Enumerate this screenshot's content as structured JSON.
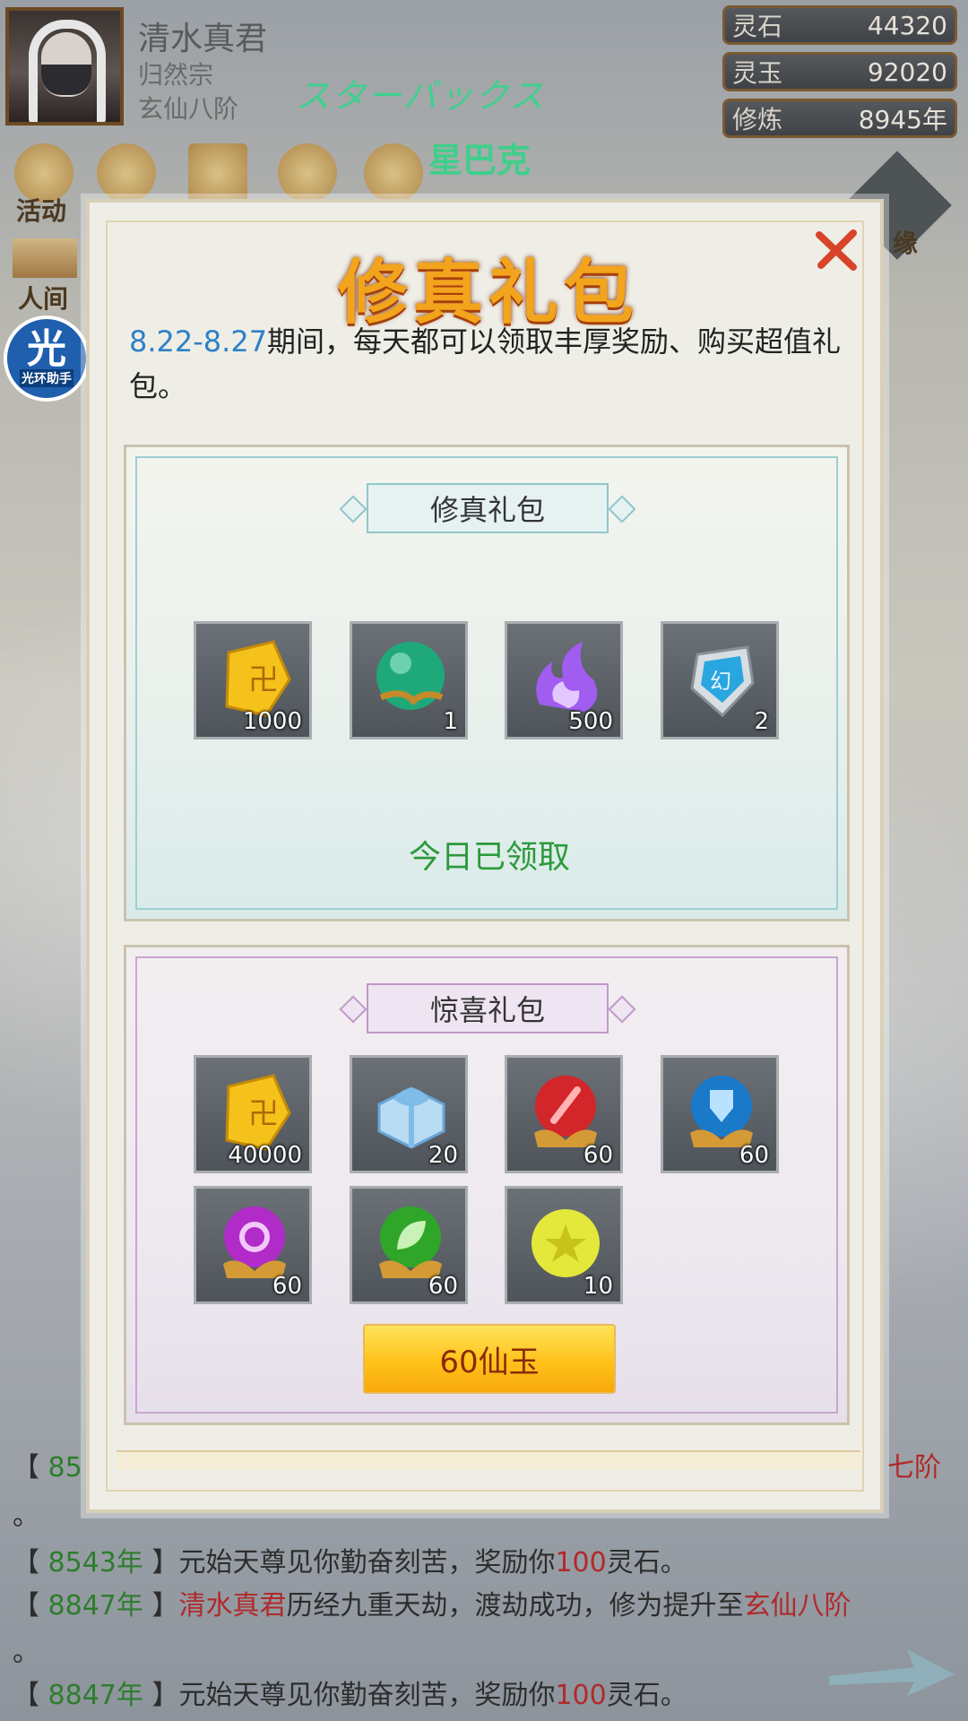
{
  "player": {
    "name": "清水真君",
    "sect": "归然宗",
    "rank": "玄仙八阶"
  },
  "overlay": {
    "jp_text": "スターバックス",
    "cn_text": "星巴克"
  },
  "resources": [
    {
      "label": "灵石",
      "value": "44320"
    },
    {
      "label": "灵玉",
      "value": "92020"
    },
    {
      "label": "修炼",
      "value": "8945年"
    }
  ],
  "side": {
    "activity": "活动",
    "human": "人间",
    "affinity": "缘",
    "helper_big": "光",
    "helper_small": "光环助手"
  },
  "modal": {
    "title": "修真礼包",
    "desc_date": "8.22-8.27",
    "desc_rest": "期间，每天都可以领取丰厚奖励、购买超值礼包。",
    "panel1": {
      "title": "修真礼包",
      "items": [
        {
          "icon": "spirit-stone-icon",
          "count": "1000"
        },
        {
          "icon": "jade-orb-icon",
          "count": "1"
        },
        {
          "icon": "purple-flame-icon",
          "count": "500"
        },
        {
          "icon": "illusion-token-icon",
          "count": "2"
        }
      ],
      "status": "今日已领取"
    },
    "panel2": {
      "title": "惊喜礼包",
      "items": [
        {
          "icon": "spirit-stone-icon",
          "count": "40000"
        },
        {
          "icon": "gift-box-icon",
          "count": "20"
        },
        {
          "icon": "red-sword-orb-icon",
          "count": "60"
        },
        {
          "icon": "blue-shield-orb-icon",
          "count": "60"
        },
        {
          "icon": "purple-swirl-orb-icon",
          "count": "60"
        },
        {
          "icon": "green-leaf-orb-icon",
          "count": "60"
        },
        {
          "icon": "yellow-star-orb-icon",
          "count": "10"
        }
      ],
      "buy_label": "60仙玉"
    }
  },
  "log": [
    {
      "year": "8543年",
      "text": "】元始天尊见你勤奋刻苦，奖励你",
      "amount": "100",
      "unit": "灵石。"
    },
    {
      "year": "8847年",
      "who": "清水真君",
      "text": "历经九重天劫，渡劫成功，修为提升至",
      "rank": "玄仙八阶"
    },
    {
      "year": "8847年",
      "text": "】元始天尊见你勤奋刻苦，奖励你",
      "amount": "100",
      "unit": "灵石。"
    }
  ],
  "log_partial": {
    "year": "85",
    "tail": "七阶"
  },
  "log_punct": "。"
}
